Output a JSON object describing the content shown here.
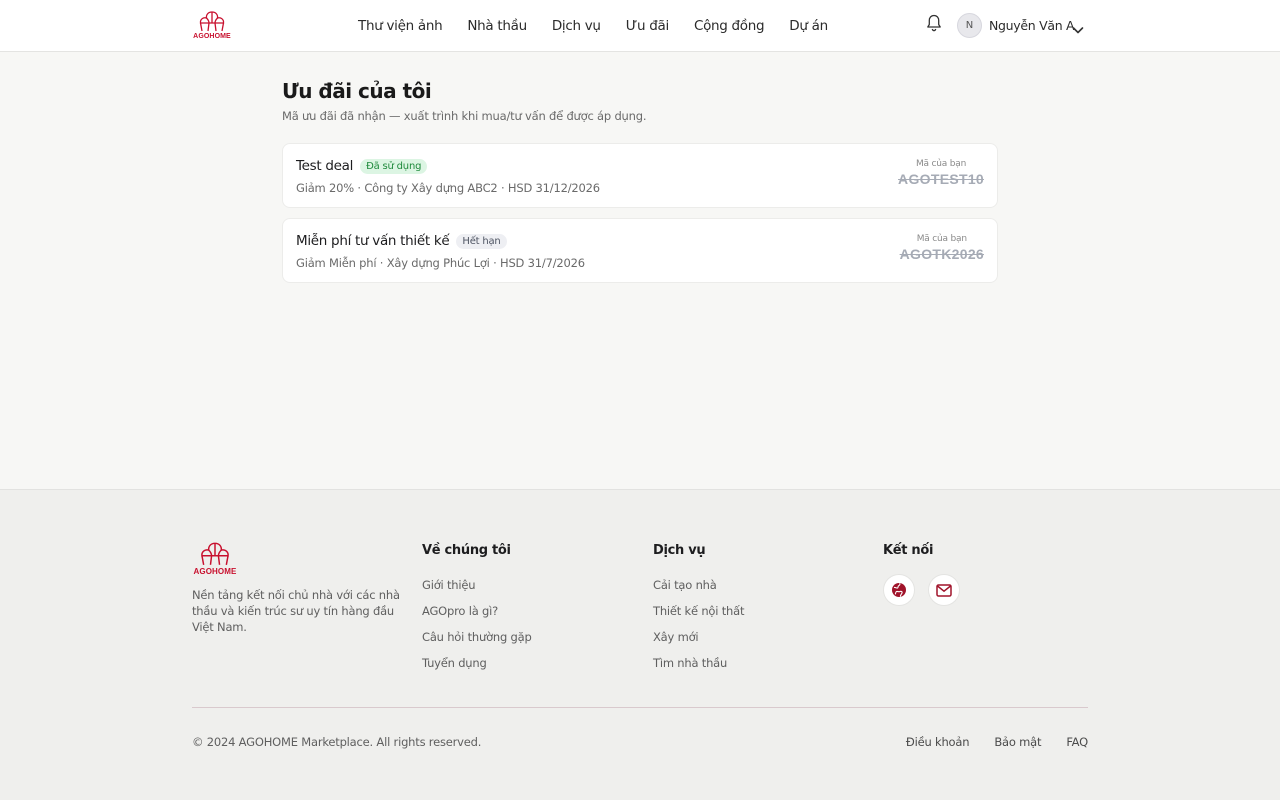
{
  "brand": {
    "name": "AGOHOME",
    "logo_text": "AGOHOME",
    "accent_color": "#c8102e"
  },
  "nav": {
    "items": [
      {
        "label": "Thư viện ảnh"
      },
      {
        "label": "Nhà thầu"
      },
      {
        "label": "Dịch vụ"
      },
      {
        "label": "Ưu đãi"
      },
      {
        "label": "Cộng đồng"
      },
      {
        "label": "Dự án"
      }
    ]
  },
  "user": {
    "initial": "N",
    "name": "Nguyễn Văn A",
    "icons": {
      "notification": "bell-icon",
      "menu": "chevron-down-icon"
    }
  },
  "page": {
    "title": "Ưu đãi của tôi",
    "subtitle": "Mã ưu đãi đã nhận — xuất trình khi mua/tư vấn để được áp dụng."
  },
  "deals": [
    {
      "title": "Test deal",
      "status": "Đã sử dụng",
      "status_color": "#1f8a3c",
      "meta": "Giảm 20% · Công ty Xây dựng ABC2 · HSD 31/12/2026",
      "code_label": "Mã của bạn",
      "code": "AGOTEST10"
    },
    {
      "title": "Miễn phí tư vấn thiết kế",
      "status": "Hết hạn",
      "status_color": "#4f5563",
      "meta": "Giảm Miễn phí · Xây dựng Phúc Lợi · HSD 31/7/2026",
      "code_label": "Mã của bạn",
      "code": "AGOTK2026"
    }
  ],
  "footer": {
    "logo_text": "AGOHOME",
    "description": "Nền tảng kết nối chủ nhà với các nhà thầu và kiến trúc sư uy tín hàng đầu Việt Nam.",
    "about": {
      "heading": "Về chúng tôi",
      "links": [
        "Giới thiệu",
        "AGOpro là gì?",
        "Câu hỏi thường gặp",
        "Tuyển dụng"
      ]
    },
    "services": {
      "heading": "Dịch vụ",
      "links": [
        "Cải tạo nhà",
        "Thiết kế nội thất",
        "Xây mới",
        "Tìm nhà thầu"
      ]
    },
    "connect": {
      "heading": "Kết nối",
      "icons": [
        "globe-icon",
        "mail-icon"
      ]
    },
    "copyright": "© 2024 AGOHOME Marketplace. All rights reserved.",
    "legal": [
      "Điều khoản",
      "Bảo mật",
      "FAQ"
    ]
  }
}
